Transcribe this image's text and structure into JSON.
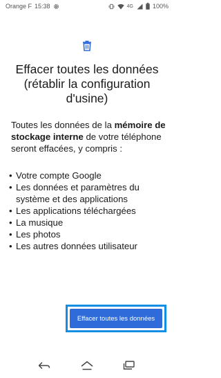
{
  "status_bar": {
    "carrier": "Orange F",
    "time": "15:38",
    "network": "4G",
    "battery": "100%"
  },
  "icons": {
    "settings": "gear-icon",
    "vibrate": "vibrate-icon",
    "wifi": "wifi-icon",
    "signal": "signal-icon",
    "battery": "battery-icon",
    "trash": "trash-icon",
    "back": "back-icon",
    "home": "home-icon",
    "recents": "recents-icon"
  },
  "colors": {
    "accent": "#2f6cd9",
    "highlight": "#0f8fe4",
    "trash_icon": "#2f6cd9"
  },
  "page": {
    "title": "Effacer toutes les données (rétablir la configuration d'usine)",
    "description_prefix": "Toutes les données de la ",
    "description_bold": "mémoire de stockage interne",
    "description_suffix": " de votre téléphone seront effacées, y compris :",
    "items": [
      "Votre compte Google",
      "Les données et paramètres du système et des applications",
      "Les applications téléchargées",
      "La musique",
      "Les photos",
      "Les autres données utilisateur"
    ],
    "bullet": "•"
  },
  "actions": {
    "erase_label": "Effacer toutes les données"
  }
}
